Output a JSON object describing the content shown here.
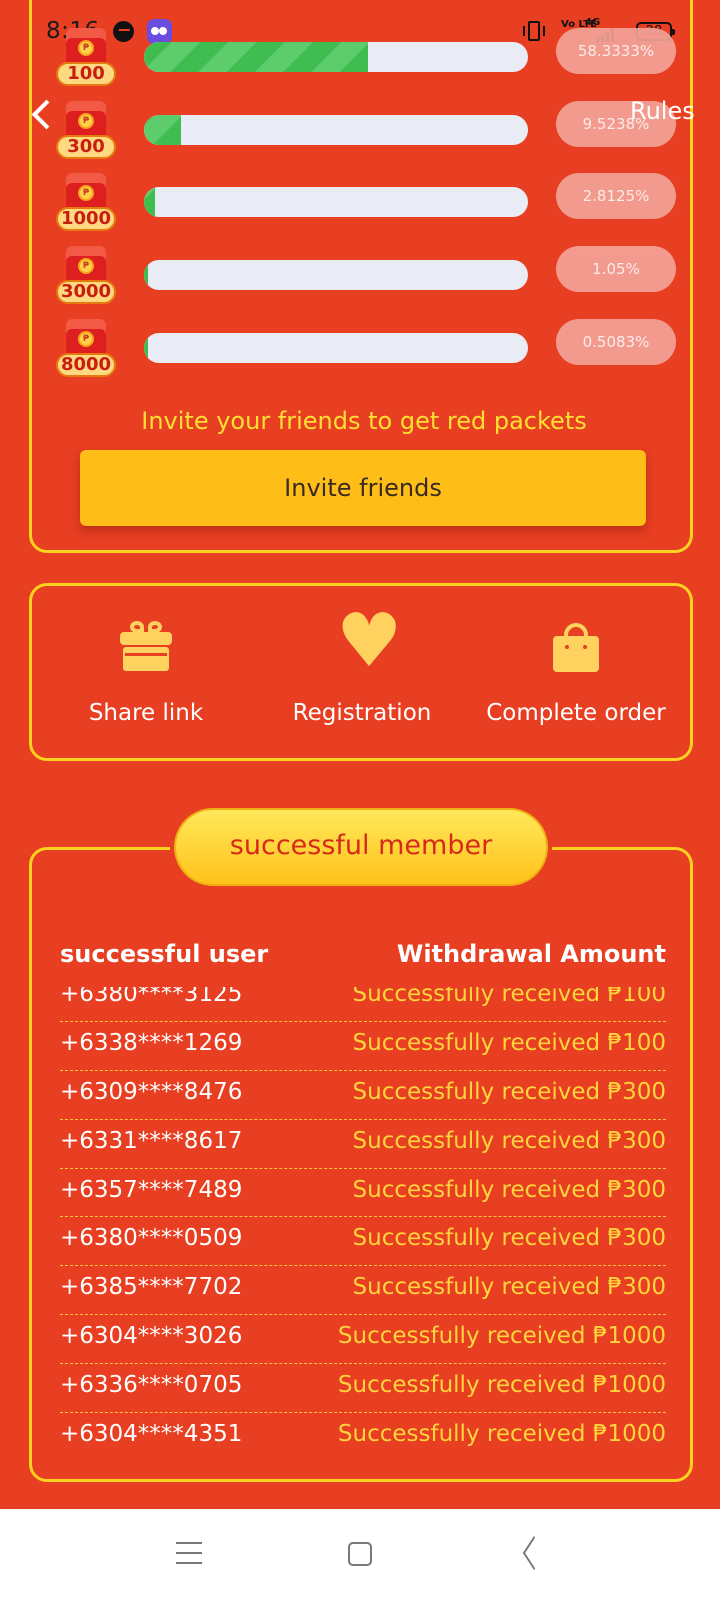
{
  "status_bar": {
    "time": "8:16",
    "icons": [
      "messenger-icon",
      "app-icon",
      "vibrate-icon",
      "volte-icon",
      "signal-icon"
    ],
    "volte_text": "Vo LTE",
    "network_text": "4G",
    "battery": "28"
  },
  "header": {
    "back_icon": "back-chevron-icon",
    "rules_label": "Rules"
  },
  "progress": {
    "packets": [
      {
        "amount": "100",
        "percent_label": "58.3333%",
        "fill": 0.583333
      },
      {
        "amount": "300",
        "percent_label": "9.5238%",
        "fill": 0.095238
      },
      {
        "amount": "1000",
        "percent_label": "2.8125%",
        "fill": 0.028125
      },
      {
        "amount": "3000",
        "percent_label": "1.05%",
        "fill": 0.0105
      },
      {
        "amount": "8000",
        "percent_label": "0.5083%",
        "fill": 0.005083
      }
    ],
    "invite_hint": "Invite your friends to get red packets",
    "invite_button": "Invite friends",
    "colors": {
      "fill": "#3fbd51",
      "track": "#e9ecf4",
      "pill": "#f5a49a"
    }
  },
  "steps": [
    {
      "icon": "gift-icon",
      "label": "Share link"
    },
    {
      "icon": "heart-icon",
      "label": "Registration"
    },
    {
      "icon": "shopping-bag-icon",
      "label": "Complete order"
    }
  ],
  "members": {
    "badge": "successful member",
    "header_user": "successful user",
    "header_amount": "Withdrawal Amount",
    "rows": [
      {
        "phone": "+6380****3125",
        "status": "Successfully received ₱100"
      },
      {
        "phone": "+6338****1269",
        "status": "Successfully received ₱100"
      },
      {
        "phone": "+6309****8476",
        "status": "Successfully received ₱300"
      },
      {
        "phone": "+6331****8617",
        "status": "Successfully received ₱300"
      },
      {
        "phone": "+6357****7489",
        "status": "Successfully received ₱300"
      },
      {
        "phone": "+6380****0509",
        "status": "Successfully received ₱300"
      },
      {
        "phone": "+6385****7702",
        "status": "Successfully received ₱300"
      },
      {
        "phone": "+6304****3026",
        "status": "Successfully received ₱1000"
      },
      {
        "phone": "+6336****0705",
        "status": "Successfully received ₱1000"
      },
      {
        "phone": "+6304****4351",
        "status": "Successfully received ₱1000"
      }
    ]
  },
  "nav_bar": {
    "icons": [
      "menu-icon",
      "home-icon",
      "back-icon"
    ]
  },
  "colors": {
    "background": "#e83e21",
    "accent_yellow": "#ffd21e",
    "button_yellow": "#ffbd18",
    "status_text": "#ffd53c"
  }
}
